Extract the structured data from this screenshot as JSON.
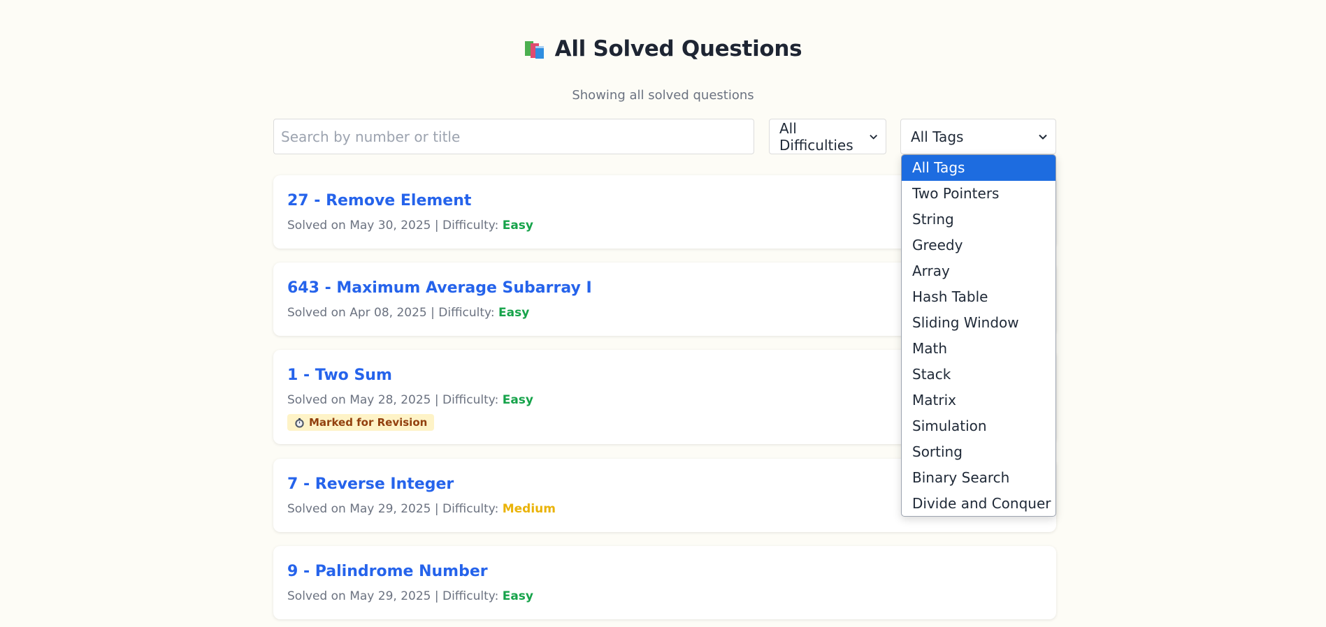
{
  "header": {
    "title": "All Solved Questions",
    "subtitle": "Showing all solved questions",
    "icon": "books-icon"
  },
  "filters": {
    "search_placeholder": "Search by number or title",
    "difficulty_selected": "All Difficulties",
    "tags_selected": "All Tags"
  },
  "tags_dropdown": {
    "options": [
      "All Tags",
      "Two Pointers",
      "String",
      "Greedy",
      "Array",
      "Hash Table",
      "Sliding Window",
      "Math",
      "Stack",
      "Matrix",
      "Simulation",
      "Sorting",
      "Binary Search",
      "Divide and Conquer"
    ],
    "selected_index": 0
  },
  "questions": [
    {
      "title": "27 - Remove Element",
      "solved_prefix": "Solved on May 30, 2025 | Difficulty: ",
      "difficulty": "Easy"
    },
    {
      "title": "643 - Maximum Average Subarray I",
      "solved_prefix": "Solved on Apr 08, 2025 | Difficulty: ",
      "difficulty": "Easy"
    },
    {
      "title": "1 - Two Sum",
      "solved_prefix": "Solved on May 28, 2025 | Difficulty: ",
      "difficulty": "Easy",
      "badge": "Marked for Revision"
    },
    {
      "title": "7 - Reverse Integer",
      "solved_prefix": "Solved on May 29, 2025 | Difficulty: ",
      "difficulty": "Medium"
    },
    {
      "title": "9 - Palindrome Number",
      "solved_prefix": "Solved on May 29, 2025 | Difficulty: ",
      "difficulty": "Easy"
    }
  ],
  "colors": {
    "background": "#fdfcf6",
    "link_blue": "#2563eb",
    "easy": "#16a34a",
    "medium": "#eab308",
    "badge_bg": "#fef3c7",
    "dropdown_highlight": "#1d6ce0"
  }
}
